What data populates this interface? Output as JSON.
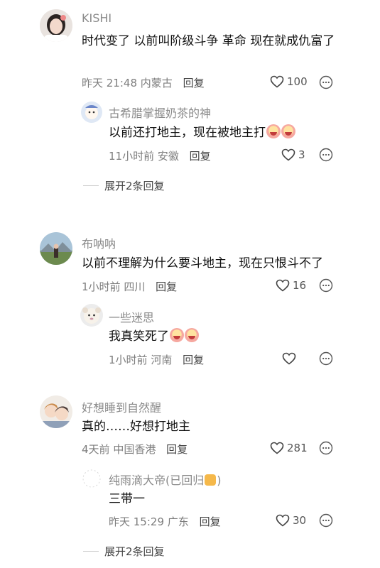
{
  "comments": [
    {
      "name": "KISHI",
      "text": "时代变了 以前叫阶级斗争 革命 现在就成仇富了",
      "time": "昨天 21:48",
      "location": "内蒙古",
      "reply_label": "回复",
      "likes": "100",
      "avatar_icon": "girl-avatar",
      "replies": [
        {
          "name": "古希腊掌握奶茶的神",
          "text": "以前还打地主，现在被地主打",
          "emojis": [
            "laughing-cry-emoji",
            "laughing-cry-emoji"
          ],
          "time": "11小时前",
          "location": "安徽",
          "reply_label": "回复",
          "likes": "3"
        }
      ],
      "expand_label": "展开2条回复"
    },
    {
      "name": "布呐呐",
      "text": "以前不理解为什么要斗地主，现在只恨斗不了",
      "time": "1小时前",
      "location": "四川",
      "reply_label": "回复",
      "likes": "16",
      "replies": [
        {
          "name": "一些迷思",
          "text": "我真笑死了",
          "emojis": [
            "laughing-cry-emoji",
            "laughing-cry-emoji"
          ],
          "time": "1小时前",
          "location": "河南",
          "reply_label": "回复",
          "likes": ""
        }
      ]
    },
    {
      "name": "好想睡到自然醒",
      "text": "真的……好想打地主",
      "time": "4天前",
      "location": "中国香港",
      "reply_label": "回复",
      "likes": "281",
      "replies": [
        {
          "name": "纯雨滴大帝(已回归",
          "name_suffix": ")",
          "text": "三带一",
          "time": "昨天 15:29",
          "location": "广东",
          "reply_label": "回复",
          "likes": "30"
        }
      ],
      "expand_label": "展开2条回复"
    }
  ],
  "colors": {
    "name": "#8a8a8a",
    "meta": "#7d7d7d",
    "text": "#111111"
  }
}
